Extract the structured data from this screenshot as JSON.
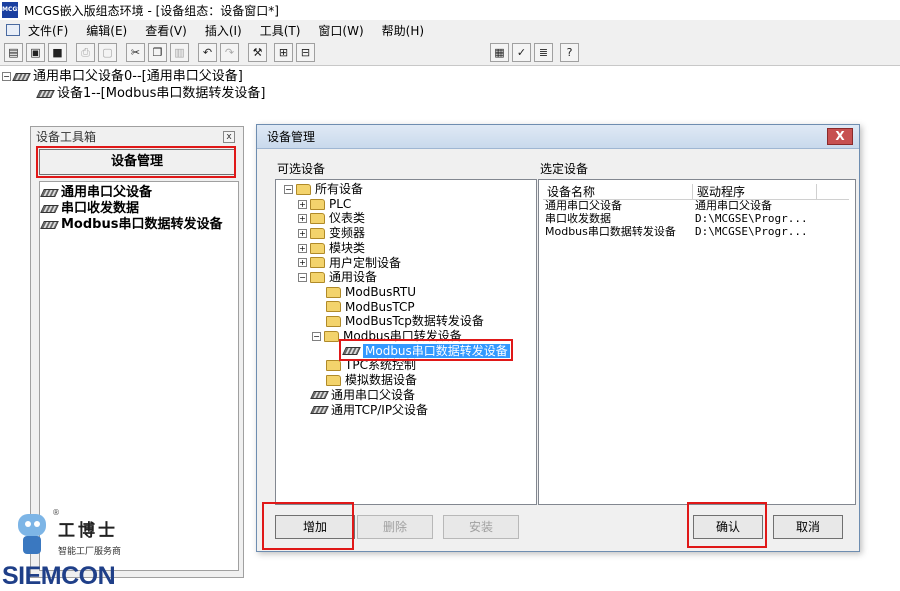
{
  "window": {
    "app_logo": "MCGS",
    "title": "MCGS嵌入版组态环境 - [设备组态：设备窗口*]"
  },
  "menu": [
    "文件(F)",
    "编辑(E)",
    "查看(V)",
    "插入(I)",
    "工具(T)",
    "窗口(W)",
    "帮助(H)"
  ],
  "device_tree": {
    "root_toggle": "−",
    "root": "通用串口父设备0--[通用串口父设备]",
    "child": "设备1--[Modbus串口数据转发设备]"
  },
  "toolbox": {
    "title": "设备工具箱",
    "close": "x",
    "manage_button": "设备管理",
    "items": [
      "通用串口父设备",
      "串口收发数据",
      "Modbus串口数据转发设备"
    ]
  },
  "dialog": {
    "title": "设备管理",
    "close": "X",
    "available_label": "可选设备",
    "selected_label": "选定设备",
    "tree": [
      {
        "toggle": "−",
        "label": "所有设备",
        "icon": "folder"
      },
      {
        "toggle": "+",
        "label": "PLC",
        "icon": "folder"
      },
      {
        "toggle": "+",
        "label": "仪表类",
        "icon": "folder"
      },
      {
        "toggle": "+",
        "label": "变频器",
        "icon": "folder"
      },
      {
        "toggle": "+",
        "label": "模块类",
        "icon": "folder"
      },
      {
        "toggle": "+",
        "label": "用户定制设备",
        "icon": "folder"
      },
      {
        "toggle": "−",
        "label": "通用设备",
        "icon": "folder"
      },
      {
        "toggle": "",
        "label": "ModBusRTU",
        "icon": "folder"
      },
      {
        "toggle": "",
        "label": "ModBusTCP",
        "icon": "folder"
      },
      {
        "toggle": "",
        "label": "ModBusTcp数据转发设备",
        "icon": "folder"
      },
      {
        "toggle": "−",
        "label": "Modbus串口转发设备",
        "icon": "folder"
      },
      {
        "toggle": "",
        "label": "Modbus串口数据转发设备",
        "icon": "chip"
      },
      {
        "toggle": "",
        "label": "TPC系统控制",
        "icon": "folder"
      },
      {
        "toggle": "",
        "label": "模拟数据设备",
        "icon": "folder"
      },
      {
        "toggle": "",
        "label": "通用串口父设备",
        "icon": "chip"
      },
      {
        "toggle": "",
        "label": "通用TCP/IP父设备",
        "icon": "chip"
      }
    ],
    "list_headers": [
      "设备名称",
      "驱动程序"
    ],
    "list_rows": [
      {
        "name": "通用串口父设备",
        "driver": "通用串口父设备"
      },
      {
        "name": "串口收发数据",
        "driver": "D:\\MCGSE\\Progr..."
      },
      {
        "name": "Modbus串口数据转发设备",
        "driver": "D:\\MCGSE\\Progr..."
      }
    ],
    "buttons": {
      "add": "增加",
      "delete": "删除",
      "install": "安装",
      "confirm": "确认",
      "cancel": "取消"
    }
  },
  "brand": {
    "cn": "工博士",
    "sub": "智能工厂服务商",
    "en": "SIEMCON",
    "reg": "®"
  },
  "colors": {
    "highlight_box": "#e01818",
    "selection": "#3399ff",
    "brand_blue": "#1f3f88"
  }
}
